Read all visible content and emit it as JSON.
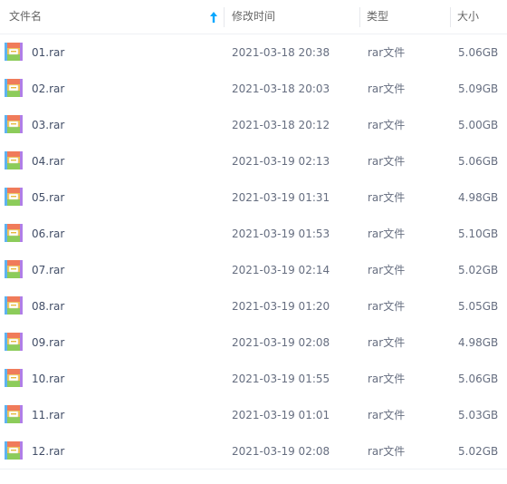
{
  "header": {
    "name_label": "文件名",
    "date_label": "修改时间",
    "type_label": "类型",
    "size_label": "大小",
    "sort_icon": "sort-ascending-arrow-icon",
    "accent_color": "#06a7ff"
  },
  "files": [
    {
      "name": "01.rar",
      "modified": "2021-03-18 20:38",
      "type": "rar文件",
      "size": "5.06GB"
    },
    {
      "name": "02.rar",
      "modified": "2021-03-18 20:03",
      "type": "rar文件",
      "size": "5.09GB"
    },
    {
      "name": "03.rar",
      "modified": "2021-03-18 20:12",
      "type": "rar文件",
      "size": "5.00GB"
    },
    {
      "name": "04.rar",
      "modified": "2021-03-19 02:13",
      "type": "rar文件",
      "size": "5.06GB"
    },
    {
      "name": "05.rar",
      "modified": "2021-03-19 01:31",
      "type": "rar文件",
      "size": "4.98GB"
    },
    {
      "name": "06.rar",
      "modified": "2021-03-19 01:53",
      "type": "rar文件",
      "size": "5.10GB"
    },
    {
      "name": "07.rar",
      "modified": "2021-03-19 02:14",
      "type": "rar文件",
      "size": "5.02GB"
    },
    {
      "name": "08.rar",
      "modified": "2021-03-19 01:20",
      "type": "rar文件",
      "size": "5.05GB"
    },
    {
      "name": "09.rar",
      "modified": "2021-03-19 02:08",
      "type": "rar文件",
      "size": "4.98GB"
    },
    {
      "name": "10.rar",
      "modified": "2021-03-19 01:55",
      "type": "rar文件",
      "size": "5.06GB"
    },
    {
      "name": "11.rar",
      "modified": "2021-03-19 01:01",
      "type": "rar文件",
      "size": "5.03GB"
    },
    {
      "name": "12.rar",
      "modified": "2021-03-19 02:08",
      "type": "rar文件",
      "size": "5.02GB"
    }
  ],
  "file_icon": "rar-archive-icon"
}
